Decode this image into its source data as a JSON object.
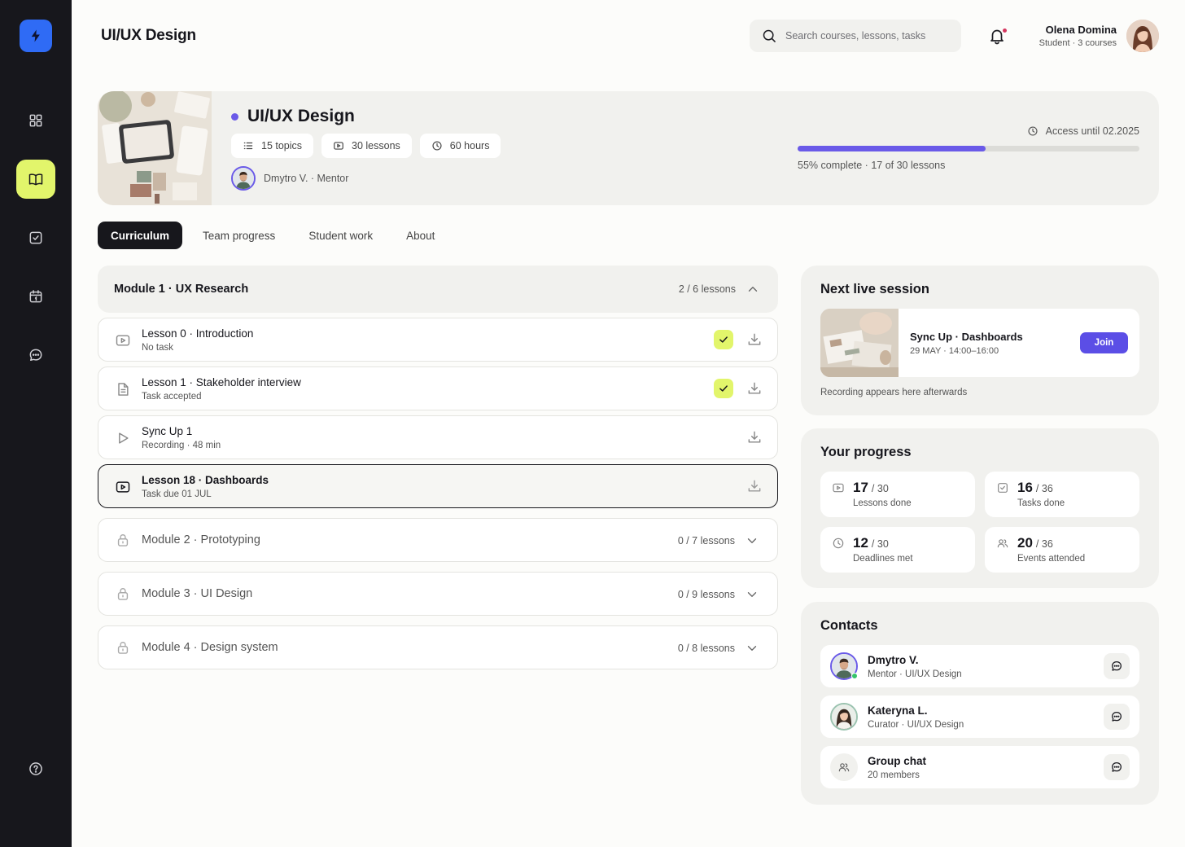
{
  "header": {
    "title": "UI/UX Design",
    "search_placeholder": "Search courses, lessons, tasks",
    "user": {
      "name": "Olena Domina",
      "subtitle": "Student · 3 courses"
    }
  },
  "sidebar": {
    "items": [
      {
        "icon": "dashboard-grid-icon"
      },
      {
        "icon": "book-icon",
        "active": true
      },
      {
        "icon": "tasks-check-icon"
      },
      {
        "icon": "calendar-icon"
      },
      {
        "icon": "chat-icon"
      },
      {
        "icon": "help-icon"
      }
    ]
  },
  "course": {
    "title": "UI/UX Design",
    "chips": [
      {
        "icon": "list-icon",
        "label": "15 topics"
      },
      {
        "icon": "video-icon",
        "label": "30 lessons"
      },
      {
        "icon": "clock-icon",
        "label": "60 hours"
      }
    ],
    "mentor": "Dmytro V. · Mentor",
    "access": "Access until 02.2025",
    "progress_percent": 55,
    "progress_text": "55% complete · 17 of 30 lessons",
    "accent_color": "#6a5ae8"
  },
  "tabs": [
    {
      "label": "Curriculum",
      "active": true
    },
    {
      "label": "Team progress"
    },
    {
      "label": "Student work"
    },
    {
      "label": "About"
    }
  ],
  "curriculum": {
    "open_module": {
      "title": "Module 1 · UX Research",
      "count": "2 / 6 lessons"
    },
    "lessons": [
      {
        "icon": "video-icon",
        "title": "Lesson 0 · Introduction",
        "subtitle": "No task",
        "done": true
      },
      {
        "icon": "document-icon",
        "title": "Lesson 1 · Stakeholder interview",
        "subtitle": "Task accepted",
        "done": true
      },
      {
        "icon": "play-icon",
        "title": "Sync Up 1",
        "subtitle": "Recording · 48 min",
        "done": false
      },
      {
        "icon": "video-icon",
        "title": "Lesson 18 · Dashboards",
        "subtitle": "Task due 01 JUL",
        "done": false,
        "current": true
      }
    ],
    "locked_modules": [
      {
        "title": "Module 2 · Prototyping",
        "count": "0 / 7 lessons"
      },
      {
        "title": "Module 3 · UI Design",
        "count": "0 / 9 lessons"
      },
      {
        "title": "Module 4 · Design system",
        "count": "0 / 8 lessons"
      }
    ]
  },
  "next_session": {
    "heading": "Next live session",
    "title": "Sync Up · Dashboards",
    "time": "29 MAY · 14:00–16:00",
    "join_label": "Join",
    "note": "Recording appears here afterwards"
  },
  "progress": {
    "heading": "Your progress",
    "stats": [
      {
        "icon": "video-icon",
        "value": "17",
        "total": "/ 30",
        "label": "Lessons done"
      },
      {
        "icon": "tasks-check-icon",
        "value": "16",
        "total": "/ 36",
        "label": "Tasks done"
      },
      {
        "icon": "clock-icon",
        "value": "12",
        "total": "/ 30",
        "label": "Deadlines met"
      },
      {
        "icon": "people-icon",
        "value": "20",
        "total": "/ 36",
        "label": "Events attended"
      }
    ]
  },
  "contacts": {
    "heading": "Contacts",
    "items": [
      {
        "name": "Dmytro V.",
        "role": "Mentor · UI/UX Design",
        "online": true
      },
      {
        "name": "Kateryna L.",
        "role": "Curator · UI/UX Design"
      },
      {
        "name": "Group chat",
        "role": "20 members"
      }
    ]
  }
}
